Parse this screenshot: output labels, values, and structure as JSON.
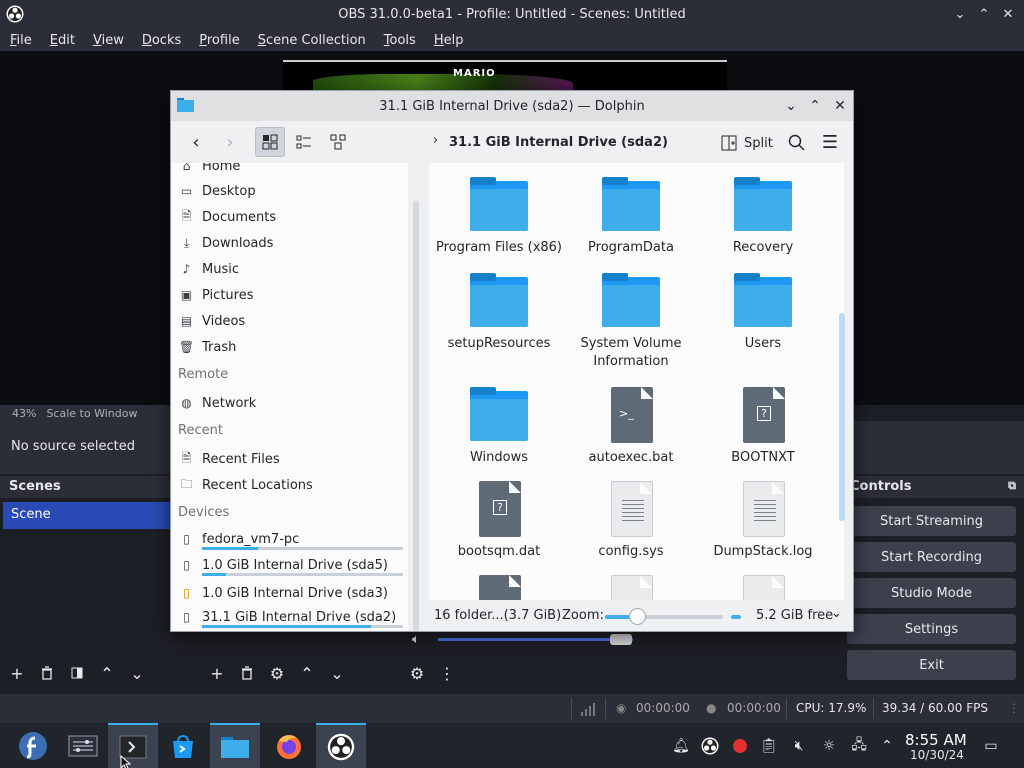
{
  "obs": {
    "title": "OBS 31.0.0-beta1 - Profile: Untitled - Scenes: Untitled",
    "menu": [
      "File",
      "Edit",
      "View",
      "Docks",
      "Profile",
      "Scene Collection",
      "Tools",
      "Help"
    ],
    "zoom_percent": "43%",
    "zoom_mode": "Scale to Window",
    "no_source": "No source selected",
    "scenes_header": "Scenes",
    "scene_item": "Scene",
    "preview_text": "MARIO",
    "controls_header": "Controls",
    "controls": [
      "Start Streaming",
      "Start Recording",
      "Studio Mode",
      "Settings",
      "Exit"
    ],
    "status": {
      "stream_time": "00:00:00",
      "record_time": "00:00:00",
      "cpu": "CPU: 17.9%",
      "fps": "39.34 / 60.00 FPS"
    }
  },
  "dolphin": {
    "title": "31.1 GiB Internal Drive (sda2) — Dolphin",
    "breadcrumb": "31.1 GiB Internal Drive (sda2)",
    "split_label": "Split",
    "places": {
      "top_partial": "Home",
      "items": [
        "Desktop",
        "Documents",
        "Downloads",
        "Music",
        "Pictures",
        "Videos",
        "Trash"
      ],
      "remote_header": "Remote",
      "remote_items": [
        "Network"
      ],
      "recent_header": "Recent",
      "recent_items": [
        "Recent Files",
        "Recent Locations"
      ],
      "devices_header": "Devices",
      "devices": [
        {
          "label": "fedora_vm7-pc",
          "fill": 0.28
        },
        {
          "label": "1.0 GiB Internal Drive (sda5)",
          "fill": 0.12
        },
        {
          "label": "1.0 GiB Internal Drive (sda3)",
          "fill": 0
        },
        {
          "label": "31.1 GiB Internal Drive (sda2)",
          "fill": 0.84
        }
      ]
    },
    "files": [
      {
        "name": "Program Files (x86)",
        "kind": "folder"
      },
      {
        "name": "ProgramData",
        "kind": "folder"
      },
      {
        "name": "Recovery",
        "kind": "folder"
      },
      {
        "name": "setupResources",
        "kind": "folder"
      },
      {
        "name": "System Volume Information",
        "kind": "folder"
      },
      {
        "name": "Users",
        "kind": "folder"
      },
      {
        "name": "Windows",
        "kind": "folder"
      },
      {
        "name": "autoexec.bat",
        "kind": "script"
      },
      {
        "name": "BOOTNXT",
        "kind": "unknown"
      },
      {
        "name": "bootsqm.dat",
        "kind": "unknown"
      },
      {
        "name": "config.sys",
        "kind": "text"
      },
      {
        "name": "DumpStack.log",
        "kind": "text"
      }
    ],
    "status": {
      "summary": "16 folder...(3.7 GiB)",
      "zoom_label": "Zoom:",
      "free_space": "5.2 GiB free"
    }
  },
  "taskbar": {
    "time": "8:55 AM",
    "date": "10/30/24"
  },
  "colors": {
    "accent": "#3daee9",
    "obs_scene_selected": "#2a4bb5",
    "record_dot": "#e03131"
  }
}
